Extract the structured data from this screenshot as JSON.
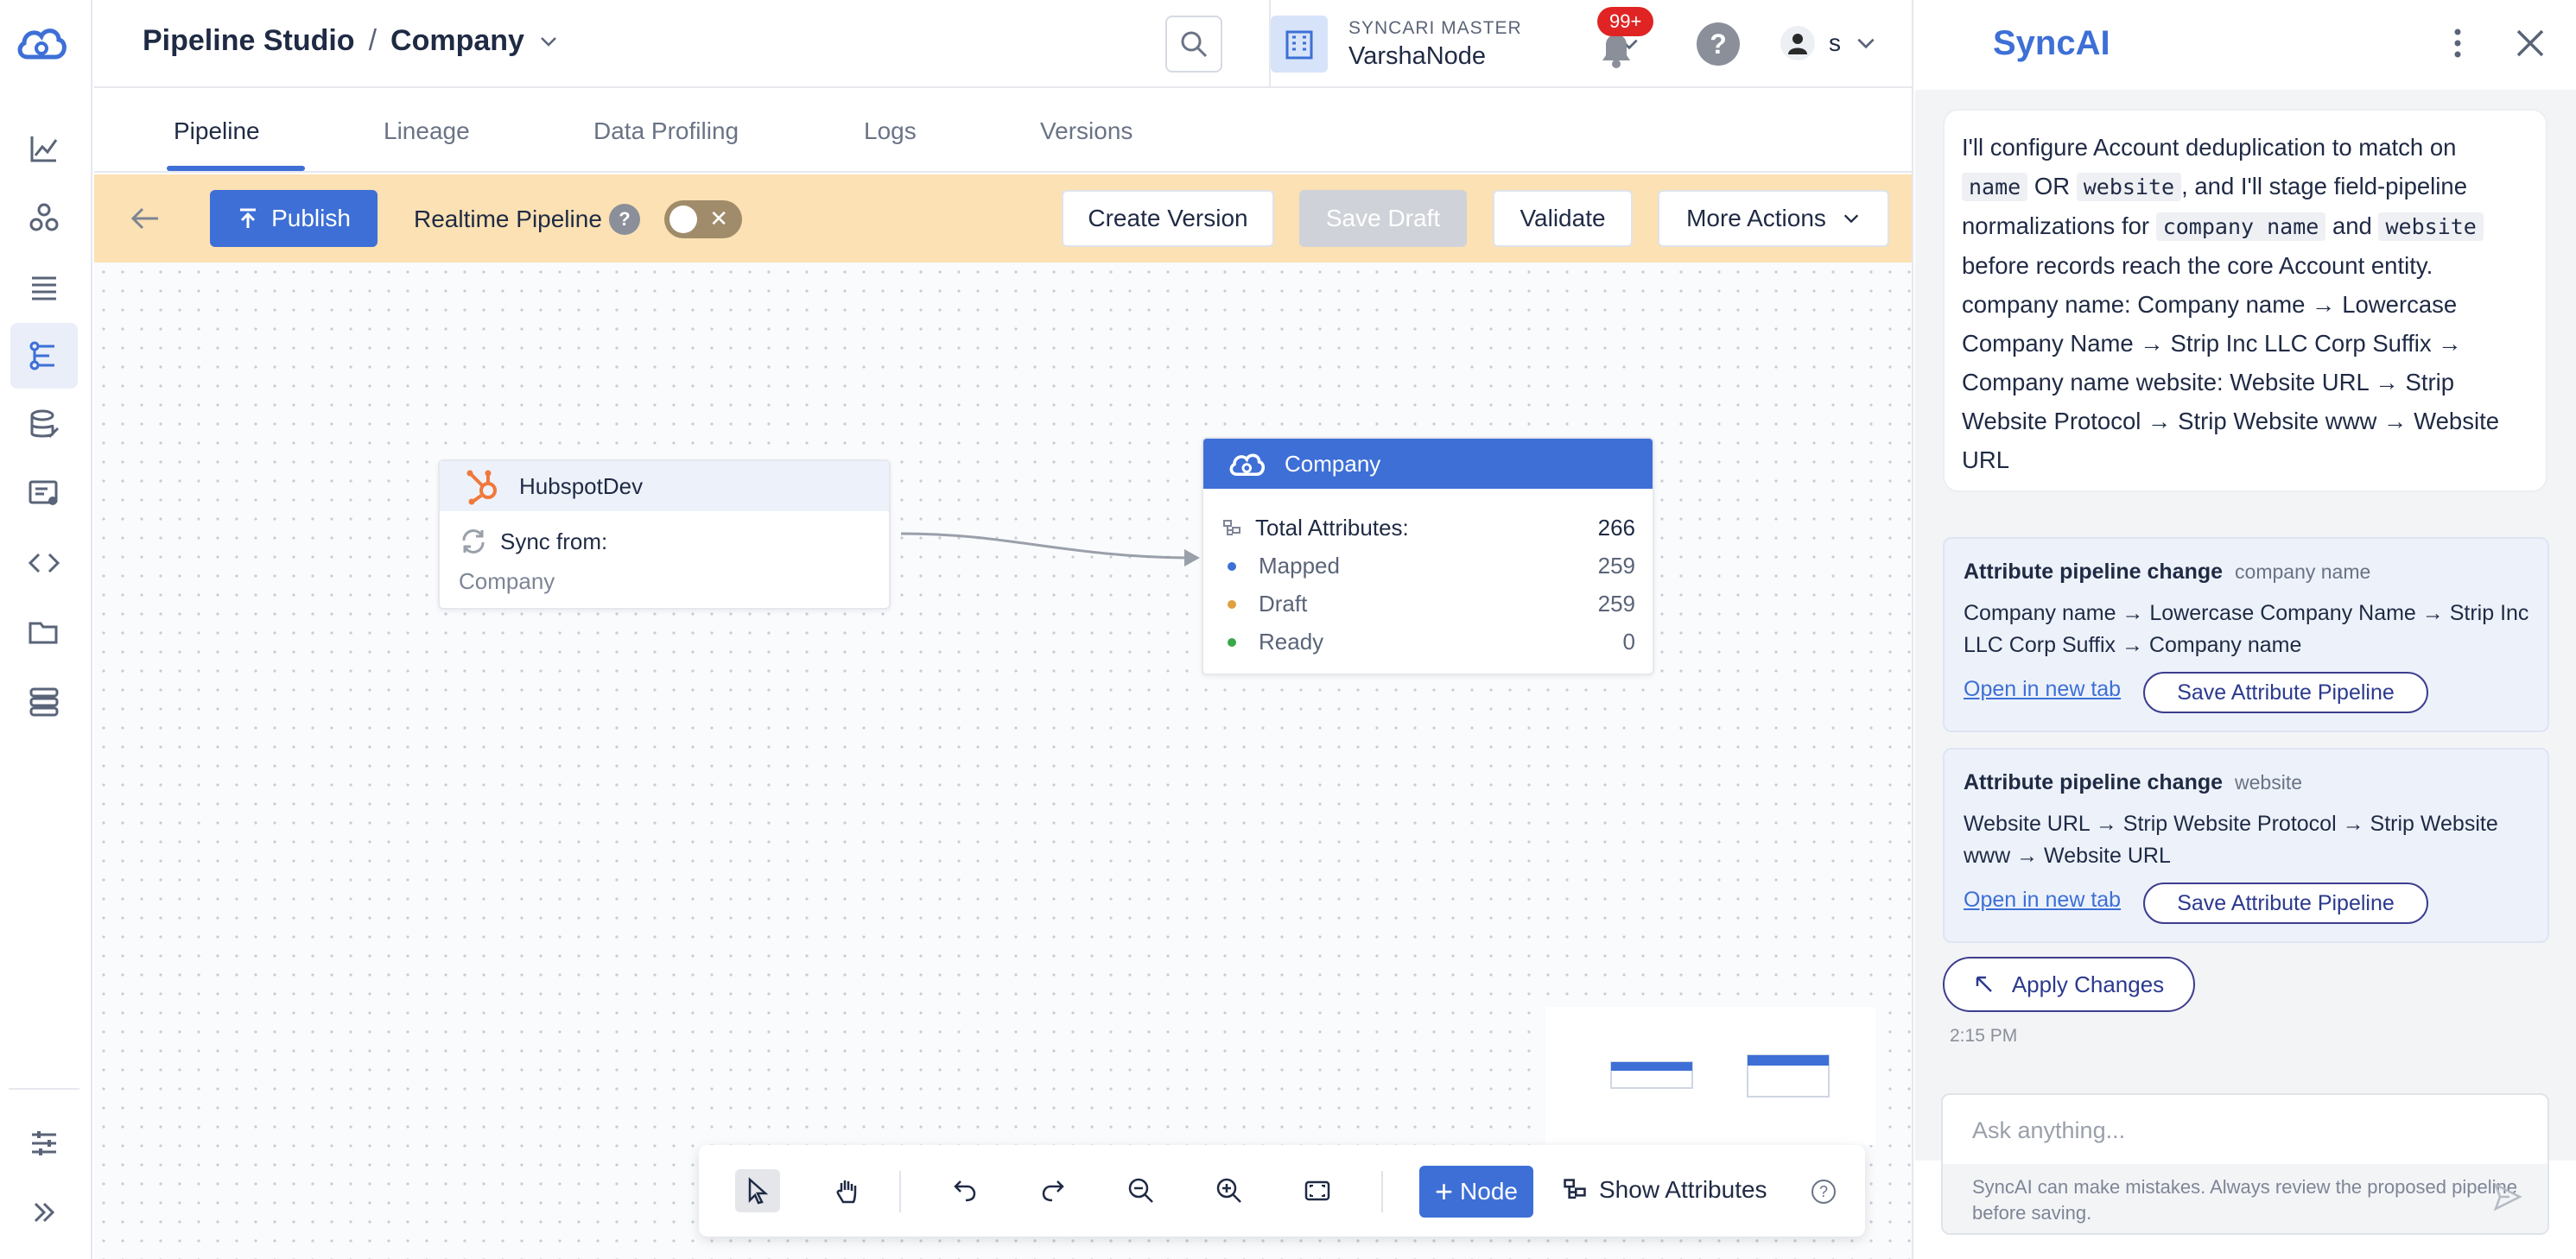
{
  "breadcrumb": {
    "root": "Pipeline Studio",
    "separator": "/",
    "current": "Company"
  },
  "org": {
    "label": "SYNCARI MASTER",
    "name": "VarshaNode"
  },
  "notifications": {
    "count": "99+"
  },
  "user": {
    "name": "s"
  },
  "tabs": [
    {
      "label": "Pipeline",
      "active": true
    },
    {
      "label": "Lineage"
    },
    {
      "label": "Data Profiling"
    },
    {
      "label": "Logs"
    },
    {
      "label": "Versions"
    }
  ],
  "toolbar": {
    "publish": "Publish",
    "realtime_label": "Realtime Pipeline",
    "realtime_enabled": false,
    "create_version": "Create Version",
    "save_draft": "Save Draft",
    "validate": "Validate",
    "more_actions": "More Actions"
  },
  "nodes": {
    "source": {
      "name": "HubspotDev",
      "sync_label": "Sync from:",
      "entity": "Company"
    },
    "target": {
      "name": "Company",
      "total_label": "Total Attributes:",
      "total": "266",
      "stats": [
        {
          "label": "Mapped",
          "value": "259",
          "color": "#3d6fd6"
        },
        {
          "label": "Draft",
          "value": "259",
          "color": "#e0a040"
        },
        {
          "label": "Ready",
          "value": "0",
          "color": "#3aa84a"
        }
      ]
    }
  },
  "controls": {
    "add_node": "Node",
    "show_attributes": "Show Attributes"
  },
  "panel": {
    "title": "SyncAI",
    "message": {
      "p1": "I'll configure Account deduplication to match on",
      "c1": "name",
      "p2": "OR",
      "c2": "website",
      "p3": ", and I'll stage field-pipeline normalizations for",
      "c3": "company name",
      "p4": "and",
      "c4": "website",
      "p5": "before records reach the core Account entity. company name: Company name → Lowercase Company Name → Strip Inc LLC Corp Suffix → Company name website: Website URL → Strip Website Protocol → Strip Website www → Website URL"
    },
    "cards": [
      {
        "title": "Attribute pipeline change",
        "tag": "company name",
        "body": "Company name → Lowercase Company Name → Strip Inc LLC Corp Suffix → Company name",
        "link": "Open in new tab",
        "save": "Save Attribute Pipeline"
      },
      {
        "title": "Attribute pipeline change",
        "tag": "website",
        "body": "Website URL → Strip Website Protocol → Strip Website www → Website URL",
        "link": "Open in new tab",
        "save": "Save Attribute Pipeline"
      }
    ],
    "apply": "Apply Changes",
    "time": "2:15 PM",
    "input_placeholder": "Ask anything...",
    "disclaimer": "SyncAI can make mistakes. Always review the proposed pipeline before saving."
  },
  "colors": {
    "accent": "#3d6fd6",
    "toolbar_bg": "#fbe1b3",
    "hubspot": "#f0783c"
  }
}
